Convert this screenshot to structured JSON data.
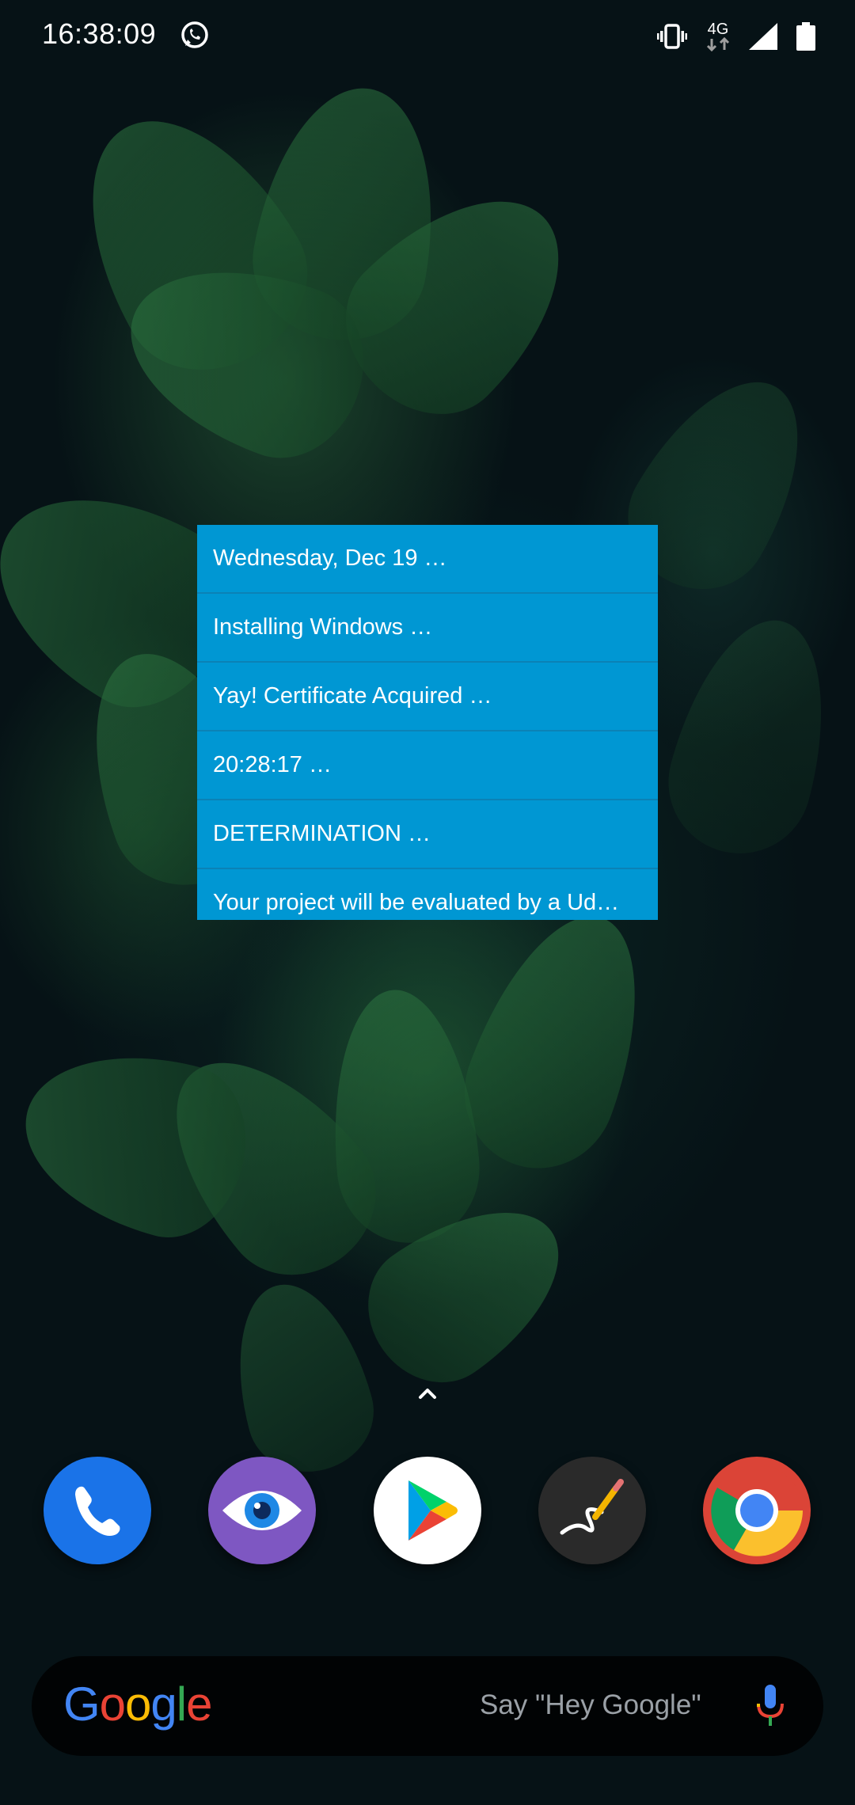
{
  "status_bar": {
    "time": "16:38:09",
    "network": "4G",
    "icons": [
      "whatsapp-icon",
      "vibrate-icon",
      "4g-data-icon",
      "signal-icon",
      "battery-icon"
    ]
  },
  "widget": {
    "accent_color": "#0097d3",
    "items": [
      {
        "label": "Wednesday, Dec 19 …"
      },
      {
        "label": "Installing Windows …"
      },
      {
        "label": "Yay! Certificate Acquired …"
      },
      {
        "label": "20:28:17 …"
      },
      {
        "label": "DETERMINATION …"
      },
      {
        "label": "Your project will be evaluated by a Ud…"
      }
    ]
  },
  "dock": {
    "apps": [
      {
        "name": "phone-icon",
        "color": "#1a73e8"
      },
      {
        "name": "eye-app-icon",
        "color": "#7e57c2"
      },
      {
        "name": "play-store-icon",
        "color": "#ffffff"
      },
      {
        "name": "drawing-app-icon",
        "color": "#2a2a2a"
      },
      {
        "name": "chrome-icon",
        "color": "#db4437"
      }
    ]
  },
  "search": {
    "logo": {
      "g1": "G",
      "o1": "o",
      "o2": "o",
      "g2": "g",
      "l": "l",
      "e": "e"
    },
    "hint": "Say \"Hey Google\""
  }
}
